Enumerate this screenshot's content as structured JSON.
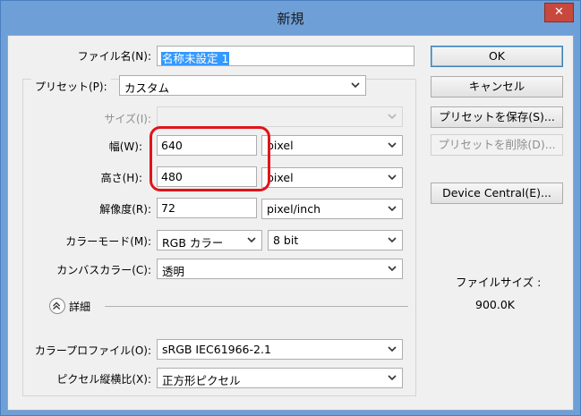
{
  "window": {
    "title": "新規",
    "close_glyph": "✕"
  },
  "form": {
    "filename": {
      "label": "ファイル名(N):",
      "value": "名称未設定 1"
    },
    "preset": {
      "label": "プリセット(P):",
      "value": "カスタム"
    },
    "size": {
      "label": "サイズ(I):",
      "value": ""
    },
    "width": {
      "label": "幅(W):",
      "value": "640",
      "unit": "pixel"
    },
    "height": {
      "label": "高さ(H):",
      "value": "480",
      "unit": "pixel"
    },
    "resolution": {
      "label": "解像度(R):",
      "value": "72",
      "unit": "pixel/inch"
    },
    "color_mode": {
      "label": "カラーモード(M):",
      "value": "RGB カラー",
      "depth": "8 bit"
    },
    "background": {
      "label": "カンバスカラー(C):",
      "value": "透明"
    },
    "details": {
      "label": "詳細"
    },
    "color_profile": {
      "label": "カラープロファイル(O):",
      "value": "sRGB IEC61966-2.1"
    },
    "pixel_aspect": {
      "label": "ピクセル縦横比(X):",
      "value": "正方形ピクセル"
    }
  },
  "buttons": {
    "ok": "OK",
    "cancel": "キャンセル",
    "save_preset": "プリセットを保存(S)...",
    "delete_preset": "プリセットを削除(D)...",
    "device_central": "Device Central(E)..."
  },
  "info": {
    "file_size_label": "ファイルサイズ :",
    "file_size_value": "900.0K"
  },
  "icons": {
    "close": "close-icon",
    "dropdown": "chevron-down-icon",
    "expander": "chevron-up-double-icon"
  },
  "colors": {
    "highlight": "#e0141b",
    "selection": "#3399ff",
    "title_bar": "#6e9fd6"
  }
}
